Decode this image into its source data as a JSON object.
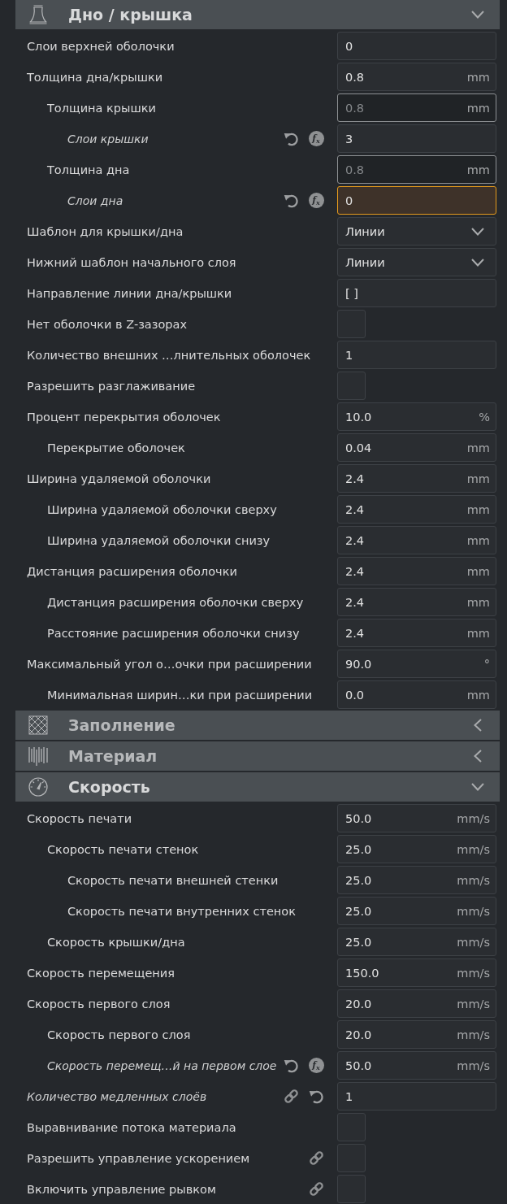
{
  "sections": [
    {
      "title": "Дно / крышка",
      "kind": "shell",
      "expanded": true,
      "settings": [
        {
          "label": "Слои верхней оболочки",
          "kind": "input",
          "value": "0"
        },
        {
          "label": "Толщина дна/крышки",
          "kind": "input",
          "value": "0.8",
          "unit": "mm",
          "children": [
            {
              "label": "Толщина крышки",
              "kind": "input",
              "value": "0.8",
              "unit": "mm",
              "disabled": true,
              "children": [
                {
                  "label": "Слои крышки",
                  "kind": "input",
                  "value": "3",
                  "italic": true,
                  "resettable": true,
                  "formula": "f$_{x}$"
                }
              ]
            },
            {
              "label": "Толщина дна",
              "kind": "input",
              "value": "0.8",
              "unit": "mm",
              "disabled": true,
              "children": [
                {
                  "label": "Слои дна",
                  "kind": "input",
                  "value": "0",
                  "italic": true,
                  "resettable": true,
                  "formula": "f$_{x}$",
                  "warning": true
                }
              ]
            }
          ]
        },
        {
          "label": "Шаблон для крышки/дна",
          "kind": "dropdown",
          "value": "Линии"
        },
        {
          "label": "Нижний шаблон начального слоя",
          "kind": "dropdown",
          "value": "Линии"
        },
        {
          "label": "Направление линии дна/крышки",
          "kind": "input",
          "value": "[ ]"
        },
        {
          "label": "Нет оболочки в Z-зазорах",
          "kind": "checkbox",
          "checked": false
        },
        {
          "label": "Количество внешних …лнительных оболочек",
          "kind": "input",
          "value": "1"
        },
        {
          "label": "Разрешить разглаживание",
          "kind": "checkbox",
          "checked": false
        },
        {
          "label": "Процент перекрытия оболочек",
          "kind": "input",
          "value": "10.0",
          "unit": "%",
          "children": [
            {
              "label": "Перекрытие оболочек",
              "kind": "input",
              "value": "0.04",
              "unit": "mm"
            }
          ]
        },
        {
          "label": "Ширина удаляемой оболочки",
          "kind": "input",
          "value": "2.4",
          "unit": "mm",
          "children": [
            {
              "label": "Ширина удаляемой оболочки сверху",
              "kind": "input",
              "value": "2.4",
              "unit": "mm"
            },
            {
              "label": "Ширина удаляемой оболочки снизу",
              "kind": "input",
              "value": "2.4",
              "unit": "mm"
            }
          ]
        },
        {
          "label": "Дистанция расширения оболочки",
          "kind": "input",
          "value": "2.4",
          "unit": "mm",
          "children": [
            {
              "label": "Дистанция расширения оболочки сверху",
              "kind": "input",
              "value": "2.4",
              "unit": "mm"
            },
            {
              "label": "Расстояние расширения оболочки снизу",
              "kind": "input",
              "value": "2.4",
              "unit": "mm"
            }
          ]
        },
        {
          "label": "Максимальный угол о…очки при расширении",
          "kind": "input",
          "value": "90.0",
          "unit": "°",
          "children": [
            {
              "label": "Минимальная ширин…ки при расширении",
              "kind": "input",
              "value": "0.0",
              "unit": "mm"
            }
          ]
        }
      ]
    },
    {
      "title": "Заполнение",
      "kind": "infill",
      "expanded": false
    },
    {
      "title": "Материал",
      "kind": "material",
      "expanded": false
    },
    {
      "title": "Скорость",
      "kind": "speed",
      "expanded": true,
      "settings": [
        {
          "label": "Скорость печати",
          "kind": "input",
          "value": "50.0",
          "unit": "mm/s",
          "children": [
            {
              "label": "Скорость печати стенок",
              "kind": "input",
              "value": "25.0",
              "unit": "mm/s",
              "children": [
                {
                  "label": "Скорость печати внешней стенки",
                  "kind": "input",
                  "value": "25.0",
                  "unit": "mm/s"
                },
                {
                  "label": "Скорость печати внутренних стенок",
                  "kind": "input",
                  "value": "25.0",
                  "unit": "mm/s"
                }
              ]
            },
            {
              "label": "Скорость крышки/дна",
              "kind": "input",
              "value": "25.0",
              "unit": "mm/s"
            }
          ]
        },
        {
          "label": "Скорость перемещения",
          "kind": "input",
          "value": "150.0",
          "unit": "mm/s"
        },
        {
          "label": "Скорость первого слоя",
          "kind": "input",
          "value": "20.0",
          "unit": "mm/s",
          "children": [
            {
              "label": "Скорость первого слоя",
              "kind": "input",
              "value": "20.0",
              "unit": "mm/s"
            },
            {
              "label": "Скорость перемещ…й на первом слое",
              "kind": "input",
              "value": "50.0",
              "unit": "mm/s",
              "italic": true,
              "resettable": true,
              "formula": "f$_{x}$"
            }
          ]
        },
        {
          "label": "Количество медленных слоёв",
          "kind": "input",
          "value": "1",
          "italic": true,
          "linked": true,
          "resettable": true
        },
        {
          "label": "Выравнивание потока материала",
          "kind": "checkbox",
          "checked": false
        },
        {
          "label": "Разрешить управление ускорением",
          "kind": "checkbox",
          "checked": false,
          "linked": true
        },
        {
          "label": "Включить управление рывком",
          "kind": "checkbox",
          "checked": false,
          "linked": true
        }
      ]
    }
  ]
}
